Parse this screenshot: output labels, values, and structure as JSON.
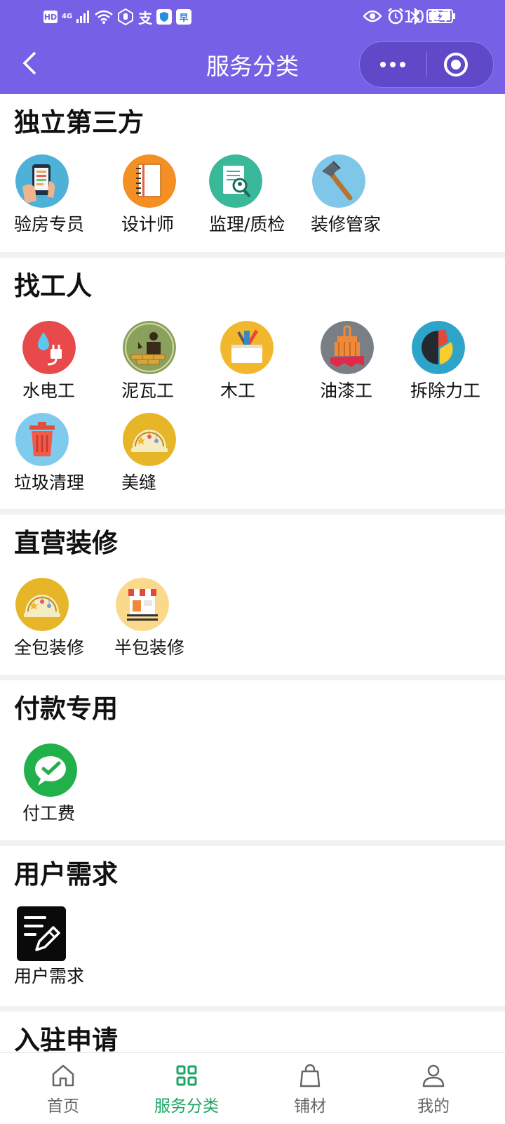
{
  "status_bar": {
    "hd": "HD",
    "network": "4G",
    "app_badge_1": "支",
    "app_badge_2": "早",
    "time": "10:27"
  },
  "header": {
    "title": "服务分类"
  },
  "sections": [
    {
      "title": "独立第三方",
      "items": [
        {
          "label": "验房专员",
          "icon": "phone-checklist-icon"
        },
        {
          "label": "设计师",
          "icon": "notebook-icon"
        },
        {
          "label": "监理/质检",
          "icon": "document-inspect-icon"
        },
        {
          "label": "装修管家",
          "icon": "hammer-icon"
        }
      ]
    },
    {
      "title": "找工人",
      "items": [
        {
          "label": "水电工",
          "icon": "water-plug-icon"
        },
        {
          "label": "泥瓦工",
          "icon": "bricklayer-icon"
        },
        {
          "label": "木工",
          "icon": "toolbox-icon"
        },
        {
          "label": "油漆工",
          "icon": "paint-brush-icon"
        },
        {
          "label": "拆除力工",
          "icon": "demolition-icon"
        },
        {
          "label": "垃圾清理",
          "icon": "trash-bin-icon"
        },
        {
          "label": "美缝",
          "icon": "helmet-icon"
        }
      ]
    },
    {
      "title": "直营装修",
      "items": [
        {
          "label": "全包装修",
          "icon": "helmet-icon"
        },
        {
          "label": "半包装修",
          "icon": "storefront-icon"
        }
      ]
    },
    {
      "title": "付款专用",
      "items": [
        {
          "label": "付工费",
          "icon": "wechat-pay-icon"
        }
      ]
    },
    {
      "title": "用户需求",
      "items": [
        {
          "label": "用户需求",
          "icon": "note-edit-icon"
        }
      ]
    },
    {
      "title": "入驻申请",
      "items": []
    }
  ],
  "tabbar": {
    "tabs": [
      {
        "label": "首页",
        "icon": "home-icon",
        "active": false
      },
      {
        "label": "服务分类",
        "icon": "grid-icon",
        "active": true
      },
      {
        "label": "铺材",
        "icon": "shopping-bag-icon",
        "active": false
      },
      {
        "label": "我的",
        "icon": "user-icon",
        "active": false
      }
    ]
  },
  "colors": {
    "header_bg": "#7661e6",
    "active_tab": "#1aa561",
    "inactive_tab": "#666666"
  }
}
